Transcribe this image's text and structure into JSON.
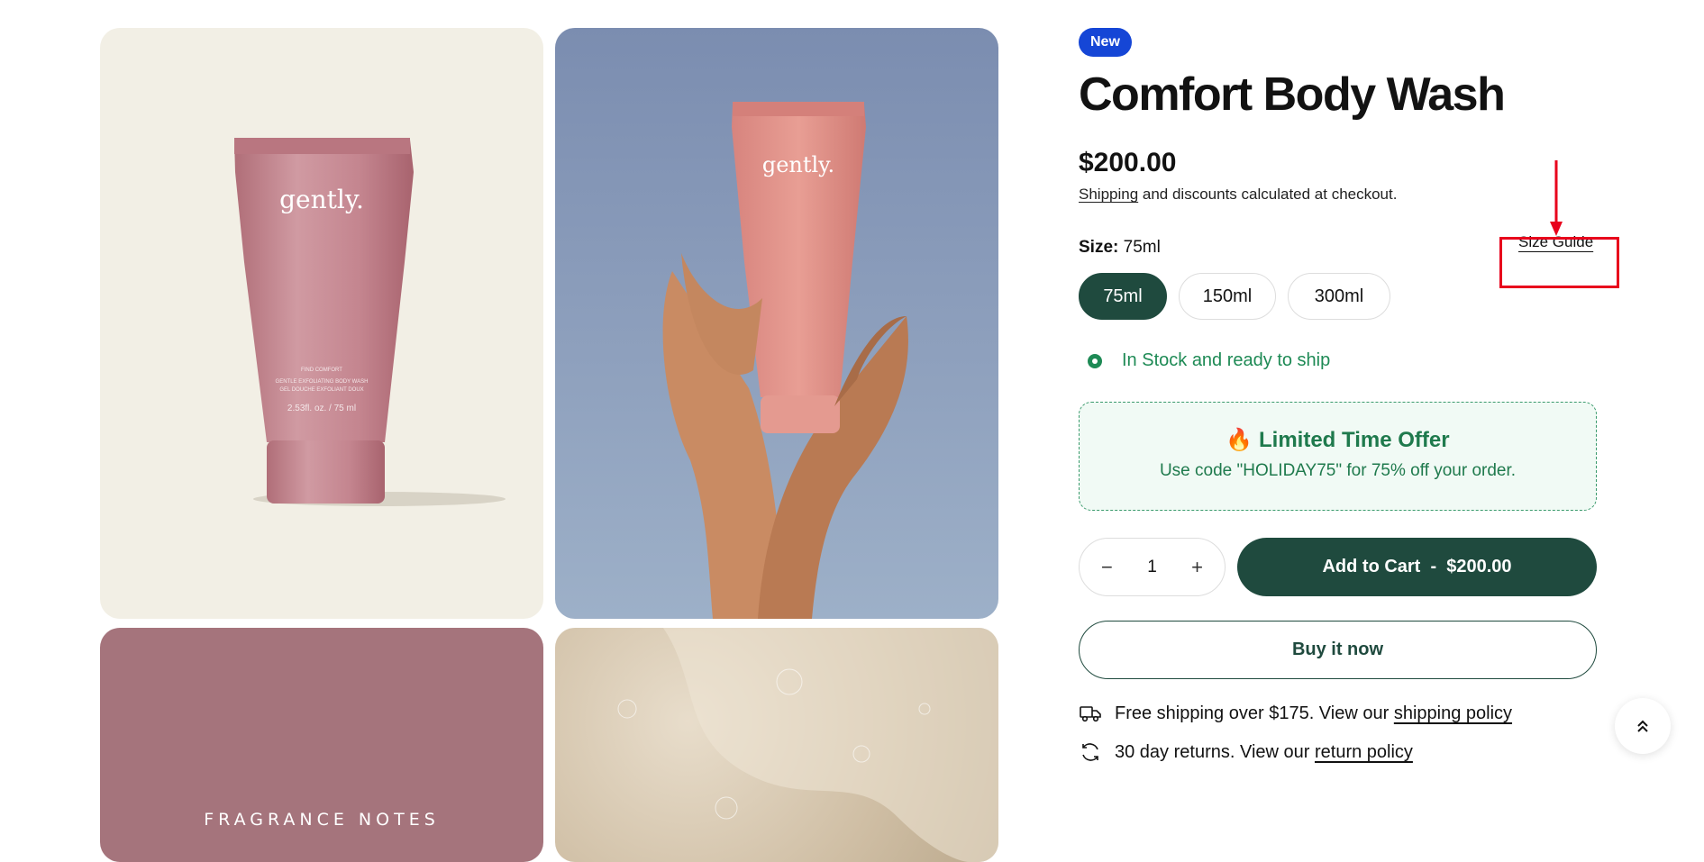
{
  "product": {
    "badge": "New",
    "title": "Comfort Body Wash",
    "price": "$200.00",
    "shipping_link": "Shipping",
    "shipping_note": " and discounts calculated at checkout."
  },
  "size": {
    "label": "Size:",
    "selected_value": "75ml",
    "guide_label": "Size Guide",
    "options": [
      "75ml",
      "150ml",
      "300ml"
    ]
  },
  "stock": {
    "text": "In Stock and ready to ship"
  },
  "offer": {
    "icon": "🔥",
    "title": "Limited Time Offer",
    "text": "Use code \"HOLIDAY75\" for 75% off your order."
  },
  "cart": {
    "qty_minus": "−",
    "quantity": "1",
    "qty_plus": "+",
    "add_label": "Add to Cart  -  $200.00",
    "buy_now_label": "Buy it now"
  },
  "perks": {
    "shipping_text": "Free shipping over $175. View our ",
    "shipping_link": "shipping policy",
    "returns_text": "30 day returns. View our ",
    "returns_link": "return policy"
  },
  "gallery": {
    "brand": "gently.",
    "tube_caption_1": "FIND COMFORT",
    "tube_caption_2": "GENTLE EXFOLIATING BODY WASH",
    "tube_caption_3": "GEL DOUCHE EXFOLIANT DOUX",
    "tube_size": "2.53fl. oz. / 75 ml",
    "fragrance_label": "FRAGRANCE NOTES"
  },
  "colors": {
    "accent_green": "#1f4a3e",
    "badge_blue": "#1546d6",
    "stock_green": "#1e8a55",
    "annotation_red": "#e8001c"
  },
  "icons": [
    "flame-icon",
    "truck-icon",
    "refresh-icon",
    "chevron-up-icon",
    "arrow-annotation"
  ]
}
